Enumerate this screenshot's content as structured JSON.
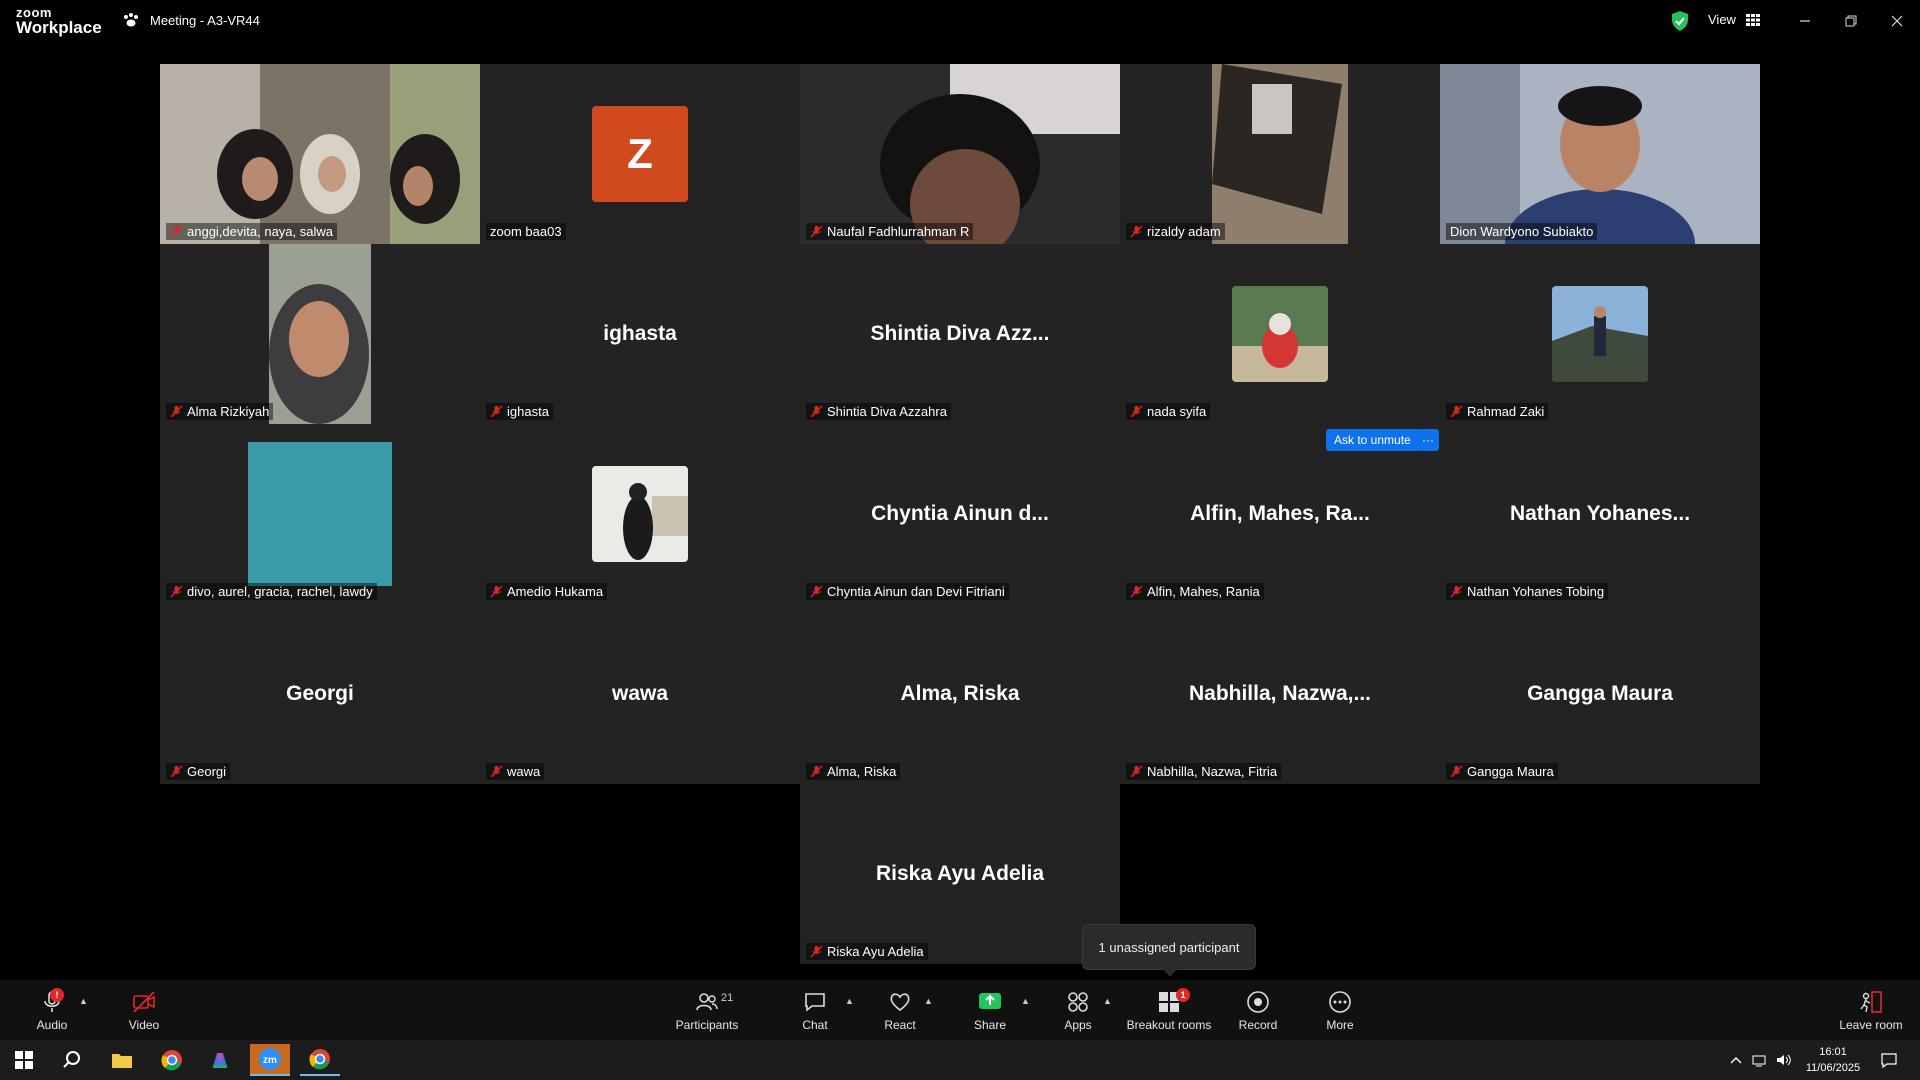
{
  "titlebar": {
    "logo_line1": "zoom",
    "logo_line2": "Workplace",
    "meeting_title": "Meeting - A3-VR44",
    "view_label": "View"
  },
  "participants": [
    {
      "name": "anggi,devita, naya, salwa",
      "type": "video"
    },
    {
      "name": "zoom baa03",
      "type": "initial",
      "initial": "Z",
      "avatar_color": "#d14a1e"
    },
    {
      "name": "Naufal Fadhlurrahman R",
      "type": "video"
    },
    {
      "name": "rizaldy adam",
      "type": "video"
    },
    {
      "name": "Dion Wardyono Subiakto",
      "type": "video",
      "active": true
    },
    {
      "name": "Alma Rizkiyah",
      "type": "video"
    },
    {
      "name": "ighasta",
      "type": "name",
      "display": "ighasta"
    },
    {
      "name": "Shintia Diva Azzahra",
      "type": "name",
      "display": "Shintia Diva Azz..."
    },
    {
      "name": "nada syifa",
      "type": "photo"
    },
    {
      "name": "Rahmad Zaki",
      "type": "photo"
    },
    {
      "name": "divo, aurel, gracia, rachel, lawdy",
      "type": "photo",
      "avatar_color": "#3a9aa7"
    },
    {
      "name": "Amedio Hukama",
      "type": "photo"
    },
    {
      "name": "Chyntia Ainun dan Devi Fitriani",
      "type": "name",
      "display": "Chyntia Ainun d..."
    },
    {
      "name": "Alfin, Mahes, Rania",
      "type": "name",
      "display": "Alfin, Mahes, Ra..."
    },
    {
      "name": "Nathan Yohanes Tobing",
      "type": "name",
      "display": "Nathan Yohanes..."
    },
    {
      "name": "Georgi",
      "type": "name",
      "display": "Georgi"
    },
    {
      "name": "wawa",
      "type": "name",
      "display": "wawa"
    },
    {
      "name": "Alma, Riska",
      "type": "name",
      "display": "Alma, Riska"
    },
    {
      "name": "Nabhilla, Nazwa, Fitria",
      "type": "name",
      "display": "Nabhilla,  Nazwa,..."
    },
    {
      "name": "Gangga Maura",
      "type": "name",
      "display": "Gangga Maura"
    },
    {
      "name": "Riska Ayu Adelia",
      "type": "name",
      "display": "Riska Ayu Adelia"
    }
  ],
  "ask_to_unmute": "Ask to unmute",
  "more_dots": "···",
  "tooltip": "1 unassigned participant",
  "toolbar": {
    "audio": "Audio",
    "video": "Video",
    "participants": "Participants",
    "participants_count": "21",
    "chat": "Chat",
    "react": "React",
    "share": "Share",
    "apps": "Apps",
    "breakout_rooms": "Breakout rooms",
    "breakout_badge": "1",
    "record": "Record",
    "more": "More",
    "leave_room": "Leave room"
  },
  "taskbar": {
    "time": "16:01",
    "date": "11/06/2025"
  },
  "colors": {
    "accent_blue": "#0e72ed",
    "active_speaker": "#23d18b",
    "share_green": "#23c45e",
    "badge_red": "#e02828"
  }
}
